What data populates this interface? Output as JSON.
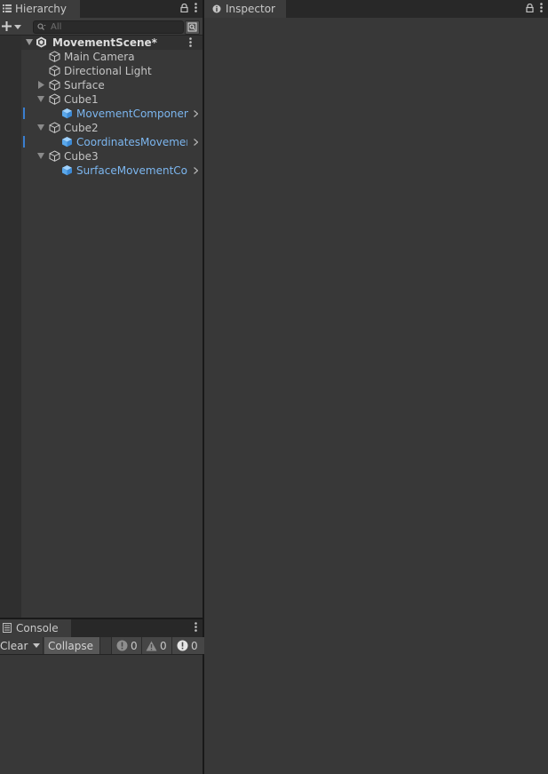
{
  "hierarchy": {
    "tab_label": "Hierarchy",
    "search_placeholder": "All",
    "scene": {
      "name": "MovementScene*"
    },
    "items": [
      {
        "label": "Main Camera"
      },
      {
        "label": "Directional Light"
      },
      {
        "label": "Surface"
      },
      {
        "label": "Cube1"
      },
      {
        "label": "MovementComponent"
      },
      {
        "label": "Cube2"
      },
      {
        "label": "CoordinatesMovementComponent"
      },
      {
        "label": "Cube3"
      },
      {
        "label": "SurfaceMovementComponent"
      }
    ]
  },
  "console": {
    "tab_label": "Console",
    "clear_label": "Clear",
    "collapse_label": "Collapse",
    "log_count": "0",
    "warning_count": "0",
    "error_count": "0"
  },
  "inspector": {
    "tab_label": "Inspector"
  },
  "colors": {
    "prefab_text": "#7cb6ef",
    "panel_bg": "#383838",
    "selection_marker": "#3a7fd0"
  }
}
